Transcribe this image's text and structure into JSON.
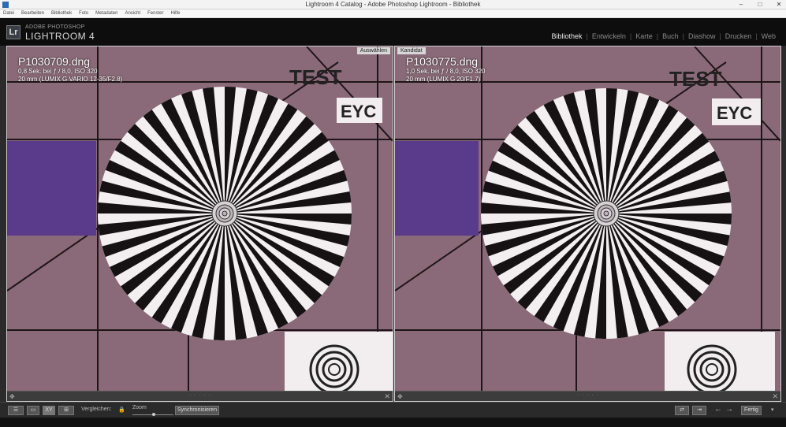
{
  "window": {
    "title": "Lightroom 4 Catalog - Adobe Photoshop Lightroom - Bibliothek",
    "buttons": [
      "–",
      "□",
      "✕"
    ]
  },
  "menu": [
    "Datei",
    "Bearbeiten",
    "Bibliothek",
    "Foto",
    "Metadaten",
    "Ansicht",
    "Fenster",
    "Hilfe"
  ],
  "identity": {
    "logo": "Lr",
    "small": "ADOBE PHOTOSHOP",
    "big": "LIGHTROOM 4"
  },
  "modules": [
    "Bibliothek",
    "Entwickeln",
    "Karte",
    "Buch",
    "Diashow",
    "Drucken",
    "Web"
  ],
  "compare": {
    "left": {
      "tag": "Auswählen",
      "filename": "P1030709.dng",
      "exposure": "0,8 Sek. bei ƒ / 8,0, ISO 320",
      "lens": "20 mm (LUMIX G VARIO 12-35/F2.8)",
      "chart_text_1": "TEST",
      "chart_text_2": "EYC"
    },
    "right": {
      "tag": "Kandidat",
      "filename": "P1030775.dng",
      "exposure": "1,0 Sek. bei ƒ / 8,0, ISO 320",
      "lens": "20 mm (LUMIX G 20/F1.7)",
      "chart_text_1": "TEST",
      "chart_text_2": "EYC"
    }
  },
  "toolbar": {
    "compare_label": "Vergleichen:",
    "zoom_label": "Zoom",
    "sync_label": "Synchronisieren",
    "done_label": "Fertig"
  },
  "colors": {
    "chart_bg": "#8a6a78",
    "swatch": "#5a3a8a"
  }
}
